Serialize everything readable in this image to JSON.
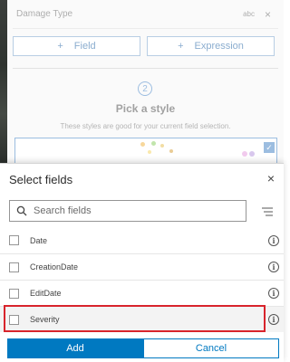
{
  "background": {
    "field_row_label": "Damage Type",
    "field_type_badge": "abc",
    "field_remove_glyph": "×",
    "add_field_label": "Field",
    "add_expression_label": "Expression",
    "plus_glyph": "+",
    "step_number": "2",
    "pick_style_title": "Pick a style",
    "pick_style_subtitle": "These styles are good for your current field selection.",
    "selected_glyph": "✓"
  },
  "dialog": {
    "title": "Select fields",
    "close_glyph": "×",
    "search": {
      "placeholder": "Search fields",
      "value": ""
    },
    "sort_icon": "sort-icon",
    "fields": [
      {
        "label": "Date",
        "checked": false,
        "info_glyph": "i"
      },
      {
        "label": "CreationDate",
        "checked": false,
        "info_glyph": "i"
      },
      {
        "label": "EditDate",
        "checked": false,
        "info_glyph": "i"
      },
      {
        "label": "Severity",
        "checked": false,
        "info_glyph": "i",
        "highlighted": true
      }
    ],
    "add_label": "Add",
    "cancel_label": "Cancel"
  },
  "colors": {
    "accent": "#0079c1",
    "highlight_outline": "#d8242c"
  }
}
